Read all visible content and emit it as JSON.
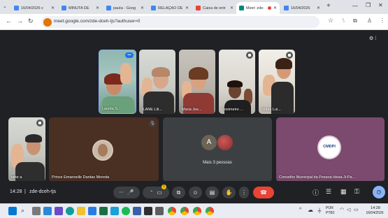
{
  "browser": {
    "tabs": [
      {
        "label": "16/04/2026 v"
      },
      {
        "label": "MINUTA DE"
      },
      {
        "label": "pauta - Goog"
      },
      {
        "label": "RELAÇÃO DE"
      },
      {
        "label": "Caixa de entr"
      },
      {
        "label": "Meet: zde-"
      },
      {
        "label": "16/04/2026"
      }
    ],
    "new_tab": "+",
    "url": "meet.google.com/zde-dceh-tjs?authuser=0"
  },
  "meet": {
    "participants": [
      {
        "name": "Laurita S..."
      },
      {
        "name": "ILANE Lili..."
      },
      {
        "name": "Maria Jos..."
      },
      {
        "name": "Rosimeire ..."
      },
      {
        "name": "Nubia Lui..."
      },
      {
        "name": "nete a"
      },
      {
        "name": "Prince Emanoelle Dantas Moreda"
      },
      {
        "name": "Mais 3 pessoas",
        "avatar_letter": "A"
      },
      {
        "name": "Conselho Municipal da Pessoa Idosa Ji-Pa...",
        "logo_text": "CMDPI"
      }
    ],
    "time": "14:28",
    "meeting_code": "zde-dceh-tjs",
    "notification_badge": "1"
  },
  "taskbar": {
    "lang": "POR",
    "lang2": "PTB2",
    "time": "14:28",
    "date": "16/04/2026"
  },
  "colors": {
    "end_call": "#ea4335",
    "accent": "#8ab4f8",
    "purple_tile": "#7b4a6e"
  }
}
